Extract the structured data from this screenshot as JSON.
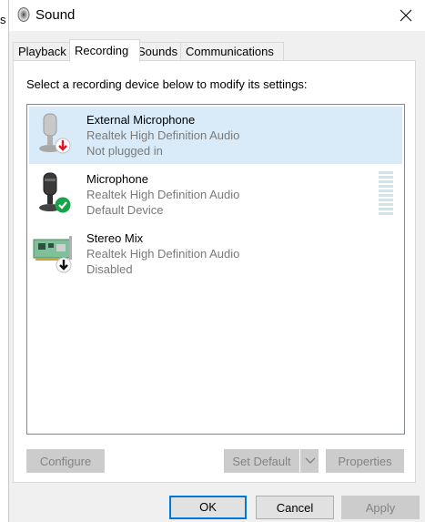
{
  "window": {
    "title": "Sound",
    "behind_char": "s"
  },
  "tabs": [
    {
      "label": "Playback",
      "active": false
    },
    {
      "label": "Recording",
      "active": true
    },
    {
      "label": "Sounds",
      "active": false
    },
    {
      "label": "Communications",
      "active": false
    }
  ],
  "instruction": "Select a recording device below to modify its settings:",
  "devices": [
    {
      "name": "External Microphone",
      "driver": "Realtek High Definition Audio",
      "status": "Not plugged in",
      "icon": "microphone-icon",
      "badge": "red-down-arrow",
      "selected": true
    },
    {
      "name": "Microphone",
      "driver": "Realtek High Definition Audio",
      "status": "Default Device",
      "icon": "microphone-icon",
      "badge": "green-check",
      "selected": false,
      "level": 0
    },
    {
      "name": "Stereo Mix",
      "driver": "Realtek High Definition Audio",
      "status": "Disabled",
      "icon": "sound-card-icon",
      "badge": "black-down-arrow",
      "selected": false
    }
  ],
  "buttons": {
    "configure": "Configure",
    "set_default": "Set Default",
    "properties": "Properties",
    "ok": "OK",
    "cancel": "Cancel",
    "apply": "Apply"
  },
  "colors": {
    "selection": "#d9ebf9",
    "default_button_border": "#0078d7",
    "check_green": "#16a34a",
    "arrow_red": "#e81123"
  }
}
